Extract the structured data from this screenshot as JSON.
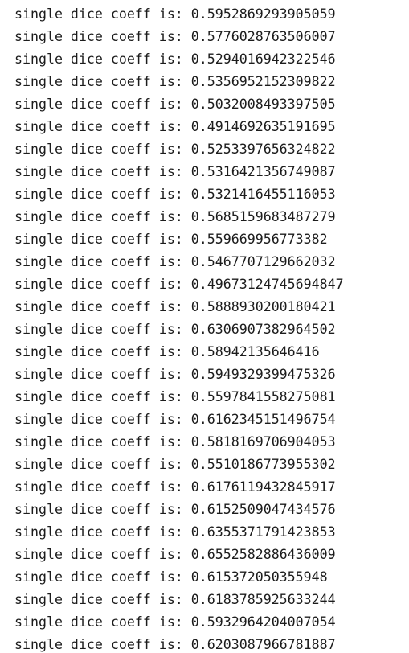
{
  "output": {
    "lines": [
      "single dice coeff is: 0.5952869293905059",
      "single dice coeff is: 0.5776028763506007",
      "single dice coeff is: 0.5294016942322546",
      "single dice coeff is: 0.5356952152309822",
      "single dice coeff is: 0.5032008493397505",
      "single dice coeff is: 0.4914692635191695",
      "single dice coeff is: 0.5253397656324822",
      "single dice coeff is: 0.5316421356749087",
      "single dice coeff is: 0.5321416455116053",
      "single dice coeff is: 0.5685159683487279",
      "single dice coeff is: 0.559669956773382",
      "single dice coeff is: 0.5467707129662032",
      "single dice coeff is: 0.49673124745694847",
      "single dice coeff is: 0.5888930200180421",
      "single dice coeff is: 0.6306907382964502",
      "single dice coeff is: 0.58942135646416",
      "single dice coeff is: 0.5949329399475326",
      "single dice coeff is: 0.5597841558275081",
      "single dice coeff is: 0.6162345151496754",
      "single dice coeff is: 0.5818169706904053",
      "single dice coeff is: 0.5510186773955302",
      "single dice coeff is: 0.6176119432845917",
      "single dice coeff is: 0.6152509047434576",
      "single dice coeff is: 0.6355371791423853",
      "single dice coeff is: 0.6552582886436009",
      "single dice coeff is: 0.615372050355948",
      "single dice coeff is: 0.6183785925633244",
      "single dice coeff is: 0.5932964204007054",
      "single dice coeff is: 0.6203087966781887"
    ]
  }
}
